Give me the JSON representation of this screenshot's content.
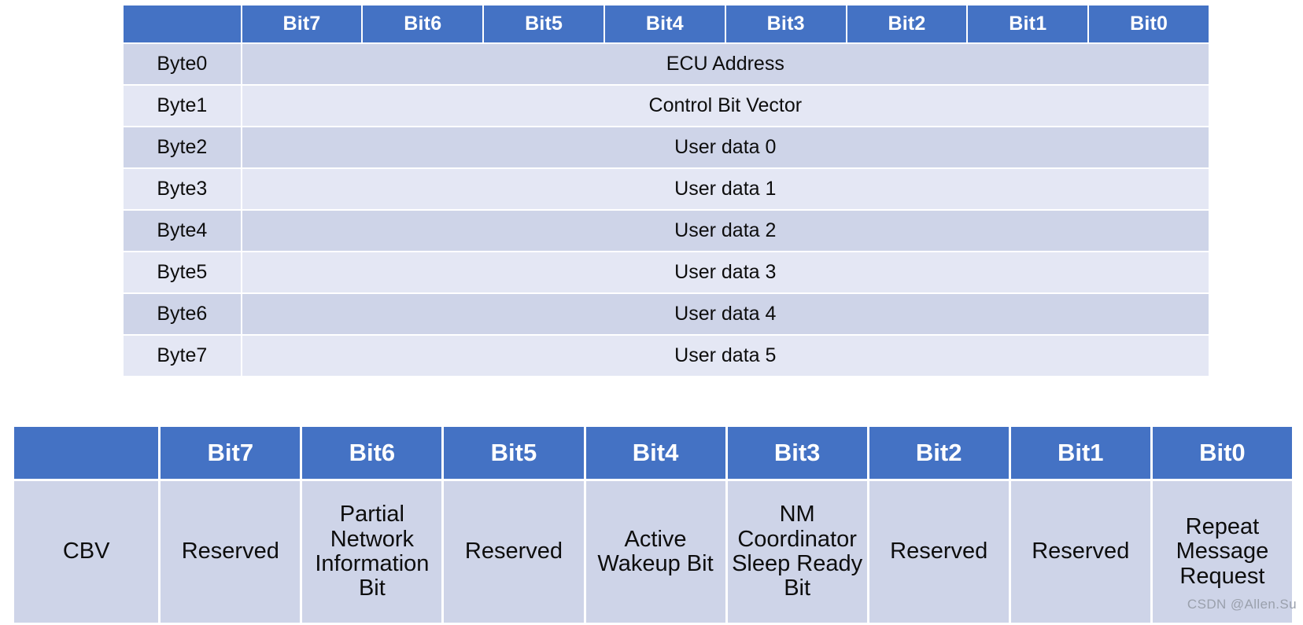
{
  "nm_pdu_table": {
    "corner_label": "",
    "bit_headers": [
      "Bit7",
      "Bit6",
      "Bit5",
      "Bit4",
      "Bit3",
      "Bit2",
      "Bit1",
      "Bit0"
    ],
    "rows": [
      {
        "byte": "Byte0",
        "content": "ECU Address"
      },
      {
        "byte": "Byte1",
        "content": "Control Bit Vector"
      },
      {
        "byte": "Byte2",
        "content": "User data 0"
      },
      {
        "byte": "Byte3",
        "content": "User data 1"
      },
      {
        "byte": "Byte4",
        "content": "User data 2"
      },
      {
        "byte": "Byte5",
        "content": "User data 3"
      },
      {
        "byte": "Byte6",
        "content": "User data 4"
      },
      {
        "byte": "Byte7",
        "content": "User data 5"
      }
    ]
  },
  "cbv_table": {
    "corner_label": "",
    "bit_headers": [
      "Bit7",
      "Bit6",
      "Bit5",
      "Bit4",
      "Bit3",
      "Bit2",
      "Bit1",
      "Bit0"
    ],
    "row_label": "CBV",
    "bit_values": [
      "Reserved",
      "Partial Network Information Bit",
      "Reserved",
      "Active Wakeup Bit",
      "NM Coordinator Sleep Ready Bit",
      "Reserved",
      "Reserved",
      "Repeat Message Request"
    ]
  },
  "watermark": {
    "text": "CSDN @Allen.Su"
  },
  "colors": {
    "header_blue": "#4472C4",
    "row_band_dark": "#CED4E8",
    "row_band_light": "#E4E7F4",
    "text": "#0d0d0d",
    "header_text": "#ffffff",
    "watermark_text": "#9aa0ac"
  }
}
